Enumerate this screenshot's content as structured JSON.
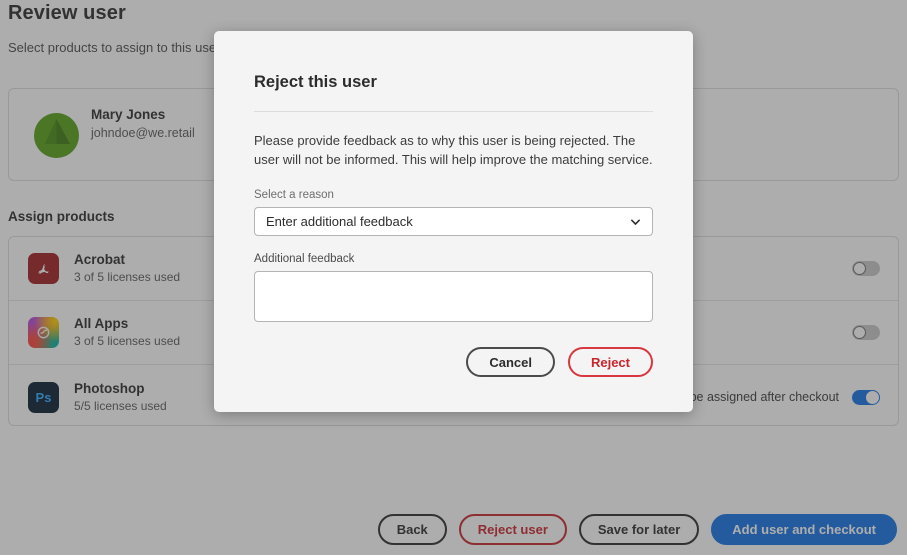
{
  "page": {
    "title": "Review user",
    "subtitle": "Select products to assign to this user",
    "assign_heading": "Assign products"
  },
  "user": {
    "name": "Mary Jones",
    "email": "johndoe@we.retail",
    "avatar_color": "#55a115"
  },
  "products": [
    {
      "icon": "acrobat-icon",
      "name": "Acrobat",
      "licenses": "3 of 5 licenses used",
      "note": "",
      "toggle_on": false
    },
    {
      "icon": "all-apps-icon",
      "name": "All Apps",
      "licenses": "3 of 5 licenses used",
      "note": "",
      "toggle_on": false
    },
    {
      "icon": "photoshop-icon",
      "name": "Photoshop",
      "licenses": "5/5 licenses used",
      "note": "License will be assigned after checkout",
      "toggle_on": true
    }
  ],
  "footer": {
    "back": "Back",
    "reject_user": "Reject user",
    "save_for_later": "Save for later",
    "add_user_checkout": "Add user and checkout"
  },
  "modal": {
    "title": "Reject this user",
    "body": "Please provide feedback as to why this user is being rejected. The user will not be informed. This will help improve the matching service.",
    "select_label": "Select a reason",
    "select_value": "Enter additional feedback",
    "textarea_label": "Additional feedback",
    "textarea_value": "",
    "cancel": "Cancel",
    "reject": "Reject"
  },
  "colors": {
    "accent_blue": "#1473e6",
    "danger_red": "#c9252d",
    "text_dark": "#2c2c2c"
  }
}
